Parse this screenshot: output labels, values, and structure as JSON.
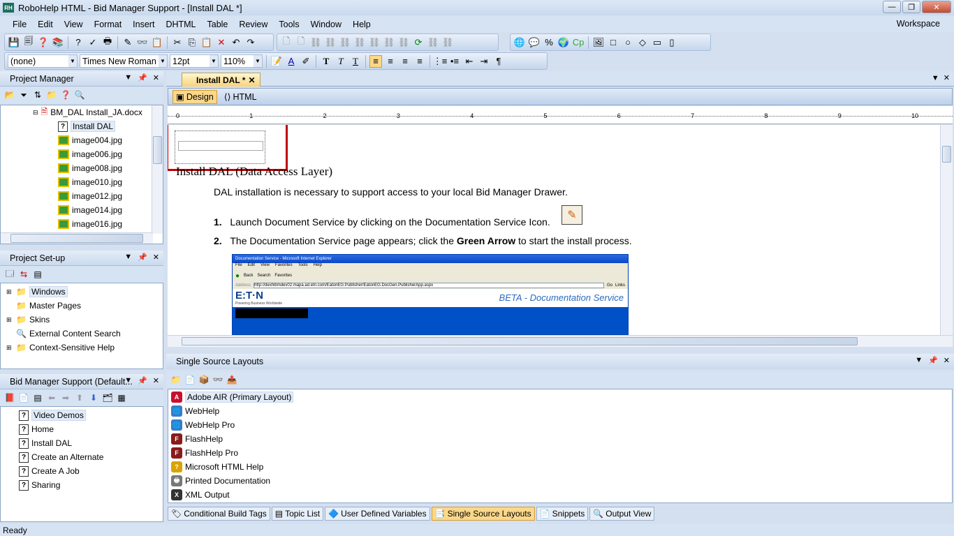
{
  "window": {
    "app_icon": "RH",
    "title": "RoboHelp HTML - Bid Manager Support - [Install DAL *]"
  },
  "menu": [
    "File",
    "Edit",
    "View",
    "Format",
    "Insert",
    "DHTML",
    "Table",
    "Review",
    "Tools",
    "Window",
    "Help"
  ],
  "workspace": "Workspace",
  "format_bar": {
    "style": "(none)",
    "font": "Times New Roman",
    "size": "12pt",
    "zoom": "110%"
  },
  "project_manager": {
    "title": "Project Manager",
    "doc": "BM_DAL Install_JA.docx",
    "items": [
      "Install DAL",
      "image004.jpg",
      "image006.jpg",
      "image008.jpg",
      "image010.jpg",
      "image012.jpg",
      "image014.jpg",
      "image016.jpg"
    ]
  },
  "project_setup": {
    "title": "Project Set-up",
    "items": [
      "Windows",
      "Master Pages",
      "Skins",
      "External Content Search",
      "Context-Sensitive Help"
    ]
  },
  "toc": {
    "title": "Bid Manager Support (Default...",
    "items": [
      "Video Demos",
      "Home",
      "Install DAL",
      "Create an Alternate",
      "Create A Job",
      "Sharing"
    ]
  },
  "editor": {
    "tab": "Install DAL *",
    "design": "Design",
    "html": "HTML",
    "ruler": [
      "0",
      "1",
      "2",
      "3",
      "4",
      "5",
      "6",
      "7",
      "8",
      "9",
      "10"
    ],
    "heading": "Install DAL (Data Access Layer)",
    "intro": "DAL installation is necessary to support access to your local Bid Manager Drawer.",
    "steps": [
      {
        "num": "1.",
        "text": "Launch Document Service by clicking on the Documentation Service Icon."
      },
      {
        "num": "2.",
        "pre": "The Documentation Service page appears; click the ",
        "bold": "Green Arrow",
        "post": " to start the install process."
      }
    ],
    "screenshot": {
      "title": "Documentation Service - Microsoft Internet Explorer",
      "menu": [
        "File",
        "Edit",
        "View",
        "Favorites",
        "Tools",
        "Help"
      ],
      "back": "Back",
      "search": "Search",
      "favorites": "Favorites",
      "address_label": "Address",
      "url": "http://dexhibmdev02.mapa.ad.etn.com/EatonEG.Publisher/EatonEG.DocGen.PublisherApp.aspx",
      "go": "Go",
      "links": "Links",
      "logo": "E:T·N",
      "tagline": "Powering Business Worldwide",
      "banner": "BETA - Documentation Service"
    }
  },
  "layouts": {
    "title": "Single Source Layouts",
    "items": [
      {
        "label": "Adobe AIR (Primary Layout)",
        "icon": "adobe-air-icon",
        "color": "#c8102e"
      },
      {
        "label": "WebHelp",
        "icon": "globe-icon",
        "color": "#3a7bc8"
      },
      {
        "label": "WebHelp Pro",
        "icon": "globe-icon",
        "color": "#3a7bc8"
      },
      {
        "label": "FlashHelp",
        "icon": "flash-icon",
        "color": "#8b1a1a"
      },
      {
        "label": "FlashHelp Pro",
        "icon": "flash-icon",
        "color": "#8b1a1a"
      },
      {
        "label": "Microsoft HTML Help",
        "icon": "html-help-icon",
        "color": "#d9a400"
      },
      {
        "label": "Printed Documentation",
        "icon": "printer-icon",
        "color": "#777777"
      },
      {
        "label": "XML Output",
        "icon": "xml-icon",
        "color": "#333333"
      }
    ]
  },
  "bottom_tabs": [
    "Conditional Build Tags",
    "Topic List",
    "User Defined Variables",
    "Single Source Layouts",
    "Snippets",
    "Output View"
  ],
  "status": "Ready",
  "colors": {
    "highlight_box": "#c00000",
    "active_tab": "#fbd88a",
    "ie_blue": "#0050c8"
  }
}
